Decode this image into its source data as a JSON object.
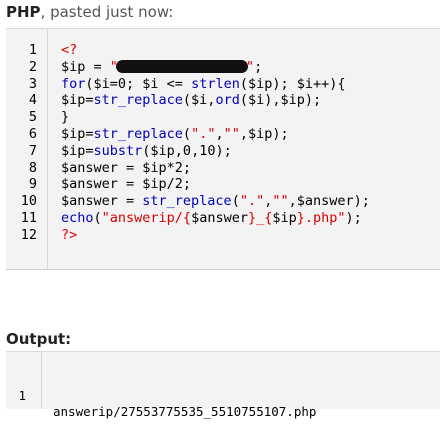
{
  "header": {
    "language": "PHP",
    "suffix": ", pasted just now:"
  },
  "code": {
    "lines": [
      {
        "n": "1",
        "tokens": [
          {
            "t": "<?",
            "c": "tag"
          }
        ]
      },
      {
        "n": "2",
        "tokens": [
          {
            "t": "$ip = ",
            "c": "pun"
          },
          {
            "t": "\"",
            "c": "str"
          },
          {
            "t": "",
            "c": "redact"
          },
          {
            "t": "\"",
            "c": "str"
          },
          {
            "t": ";",
            "c": "pun"
          }
        ]
      },
      {
        "n": "3",
        "tokens": [
          {
            "t": "for",
            "c": "kw"
          },
          {
            "t": "($i=0; $i <= ",
            "c": "pun"
          },
          {
            "t": "strlen",
            "c": "fn"
          },
          {
            "t": "($ip); $i++){",
            "c": "pun"
          }
        ]
      },
      {
        "n": "4",
        "tokens": [
          {
            "t": "$ip=",
            "c": "pun"
          },
          {
            "t": "str_replace",
            "c": "fn"
          },
          {
            "t": "($i,",
            "c": "pun"
          },
          {
            "t": "ord",
            "c": "fn"
          },
          {
            "t": "($i),$ip);",
            "c": "pun"
          }
        ]
      },
      {
        "n": "5",
        "tokens": [
          {
            "t": "}",
            "c": "pun"
          }
        ]
      },
      {
        "n": "6",
        "tokens": [
          {
            "t": "$ip=",
            "c": "pun"
          },
          {
            "t": "str_replace",
            "c": "fn"
          },
          {
            "t": "(",
            "c": "pun"
          },
          {
            "t": "\".\"",
            "c": "str"
          },
          {
            "t": ",",
            "c": "pun"
          },
          {
            "t": "\"\"",
            "c": "str"
          },
          {
            "t": ",$ip);",
            "c": "pun"
          }
        ]
      },
      {
        "n": "7",
        "tokens": [
          {
            "t": "$ip=",
            "c": "pun"
          },
          {
            "t": "substr",
            "c": "fn"
          },
          {
            "t": "($ip,0,10);",
            "c": "pun"
          }
        ]
      },
      {
        "n": "8",
        "tokens": [
          {
            "t": "$answer = $ip*2;",
            "c": "pun"
          }
        ]
      },
      {
        "n": "9",
        "tokens": [
          {
            "t": "$answer = $ip/2;",
            "c": "pun"
          }
        ]
      },
      {
        "n": "10",
        "tokens": [
          {
            "t": "$answer = ",
            "c": "pun"
          },
          {
            "t": "str_replace",
            "c": "fn"
          },
          {
            "t": "(",
            "c": "pun"
          },
          {
            "t": "\".\"",
            "c": "str"
          },
          {
            "t": ",",
            "c": "pun"
          },
          {
            "t": "\"\"",
            "c": "str"
          },
          {
            "t": ",$answer);",
            "c": "pun"
          }
        ]
      },
      {
        "n": "11",
        "tokens": [
          {
            "t": "echo",
            "c": "kw"
          },
          {
            "t": "(",
            "c": "pun"
          },
          {
            "t": "\"answerip/{",
            "c": "str"
          },
          {
            "t": "$answer",
            "c": "pun"
          },
          {
            "t": "}_{",
            "c": "str"
          },
          {
            "t": "$ip",
            "c": "pun"
          },
          {
            "t": "}.php\"",
            "c": "str"
          },
          {
            "t": ");",
            "c": "pun"
          }
        ]
      },
      {
        "n": "12",
        "tokens": [
          {
            "t": "?>",
            "c": "tag"
          }
        ]
      }
    ]
  },
  "output": {
    "title": "Output:",
    "lines": [
      {
        "n": "1",
        "text": "answerip/27553775535_5510755107.php"
      }
    ]
  }
}
